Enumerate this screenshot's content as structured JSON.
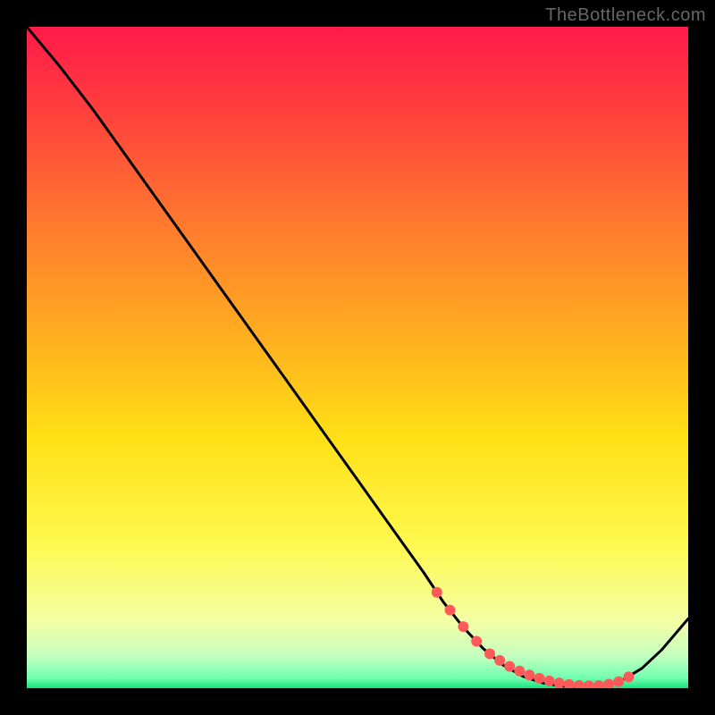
{
  "watermark": "TheBottleneck.com",
  "chart_data": {
    "type": "line",
    "title": "",
    "xlabel": "",
    "ylabel": "",
    "xlim": [
      0,
      100
    ],
    "ylim": [
      0,
      100
    ],
    "grid": false,
    "legend": false,
    "background_gradient": {
      "stops": [
        {
          "offset": 0.0,
          "color": "#ff1a4a"
        },
        {
          "offset": 0.12,
          "color": "#ff3d3d"
        },
        {
          "offset": 0.3,
          "color": "#ff7a2e"
        },
        {
          "offset": 0.48,
          "color": "#ffb21f"
        },
        {
          "offset": 0.62,
          "color": "#ffe016"
        },
        {
          "offset": 0.78,
          "color": "#fff94f"
        },
        {
          "offset": 0.9,
          "color": "#f3ffa6"
        },
        {
          "offset": 0.95,
          "color": "#c6ffbf"
        },
        {
          "offset": 0.985,
          "color": "#6fffb0"
        },
        {
          "offset": 1.0,
          "color": "#18e27a"
        }
      ]
    },
    "series": [
      {
        "name": "curve",
        "color": "#000000",
        "x": [
          0,
          5,
          10,
          15,
          20,
          25,
          30,
          35,
          40,
          45,
          50,
          55,
          60,
          63,
          66,
          69,
          72,
          75,
          78,
          81,
          84,
          86,
          88,
          90,
          93,
          96,
          100
        ],
        "y": [
          100,
          94,
          87.5,
          80.5,
          73.5,
          66.5,
          59.5,
          52.5,
          45.5,
          38.5,
          31.5,
          24.5,
          17.5,
          13,
          9.2,
          6.0,
          3.5,
          1.8,
          0.8,
          0.3,
          0.2,
          0.3,
          0.6,
          1.2,
          3.0,
          5.8,
          10.5
        ]
      }
    ],
    "markers": {
      "name": "fit-dots",
      "color": "#ff5a5a",
      "radius_px": 6,
      "x": [
        62,
        64,
        66,
        68,
        70,
        71.5,
        73,
        74.5,
        76,
        77.5,
        79,
        80.5,
        82,
        83.5,
        85,
        86.5,
        88,
        89.5,
        91
      ],
      "y": [
        14.5,
        11.8,
        9.3,
        7.1,
        5.2,
        4.2,
        3.3,
        2.6,
        2.0,
        1.5,
        1.1,
        0.8,
        0.55,
        0.4,
        0.35,
        0.4,
        0.6,
        1.0,
        1.7
      ]
    }
  }
}
